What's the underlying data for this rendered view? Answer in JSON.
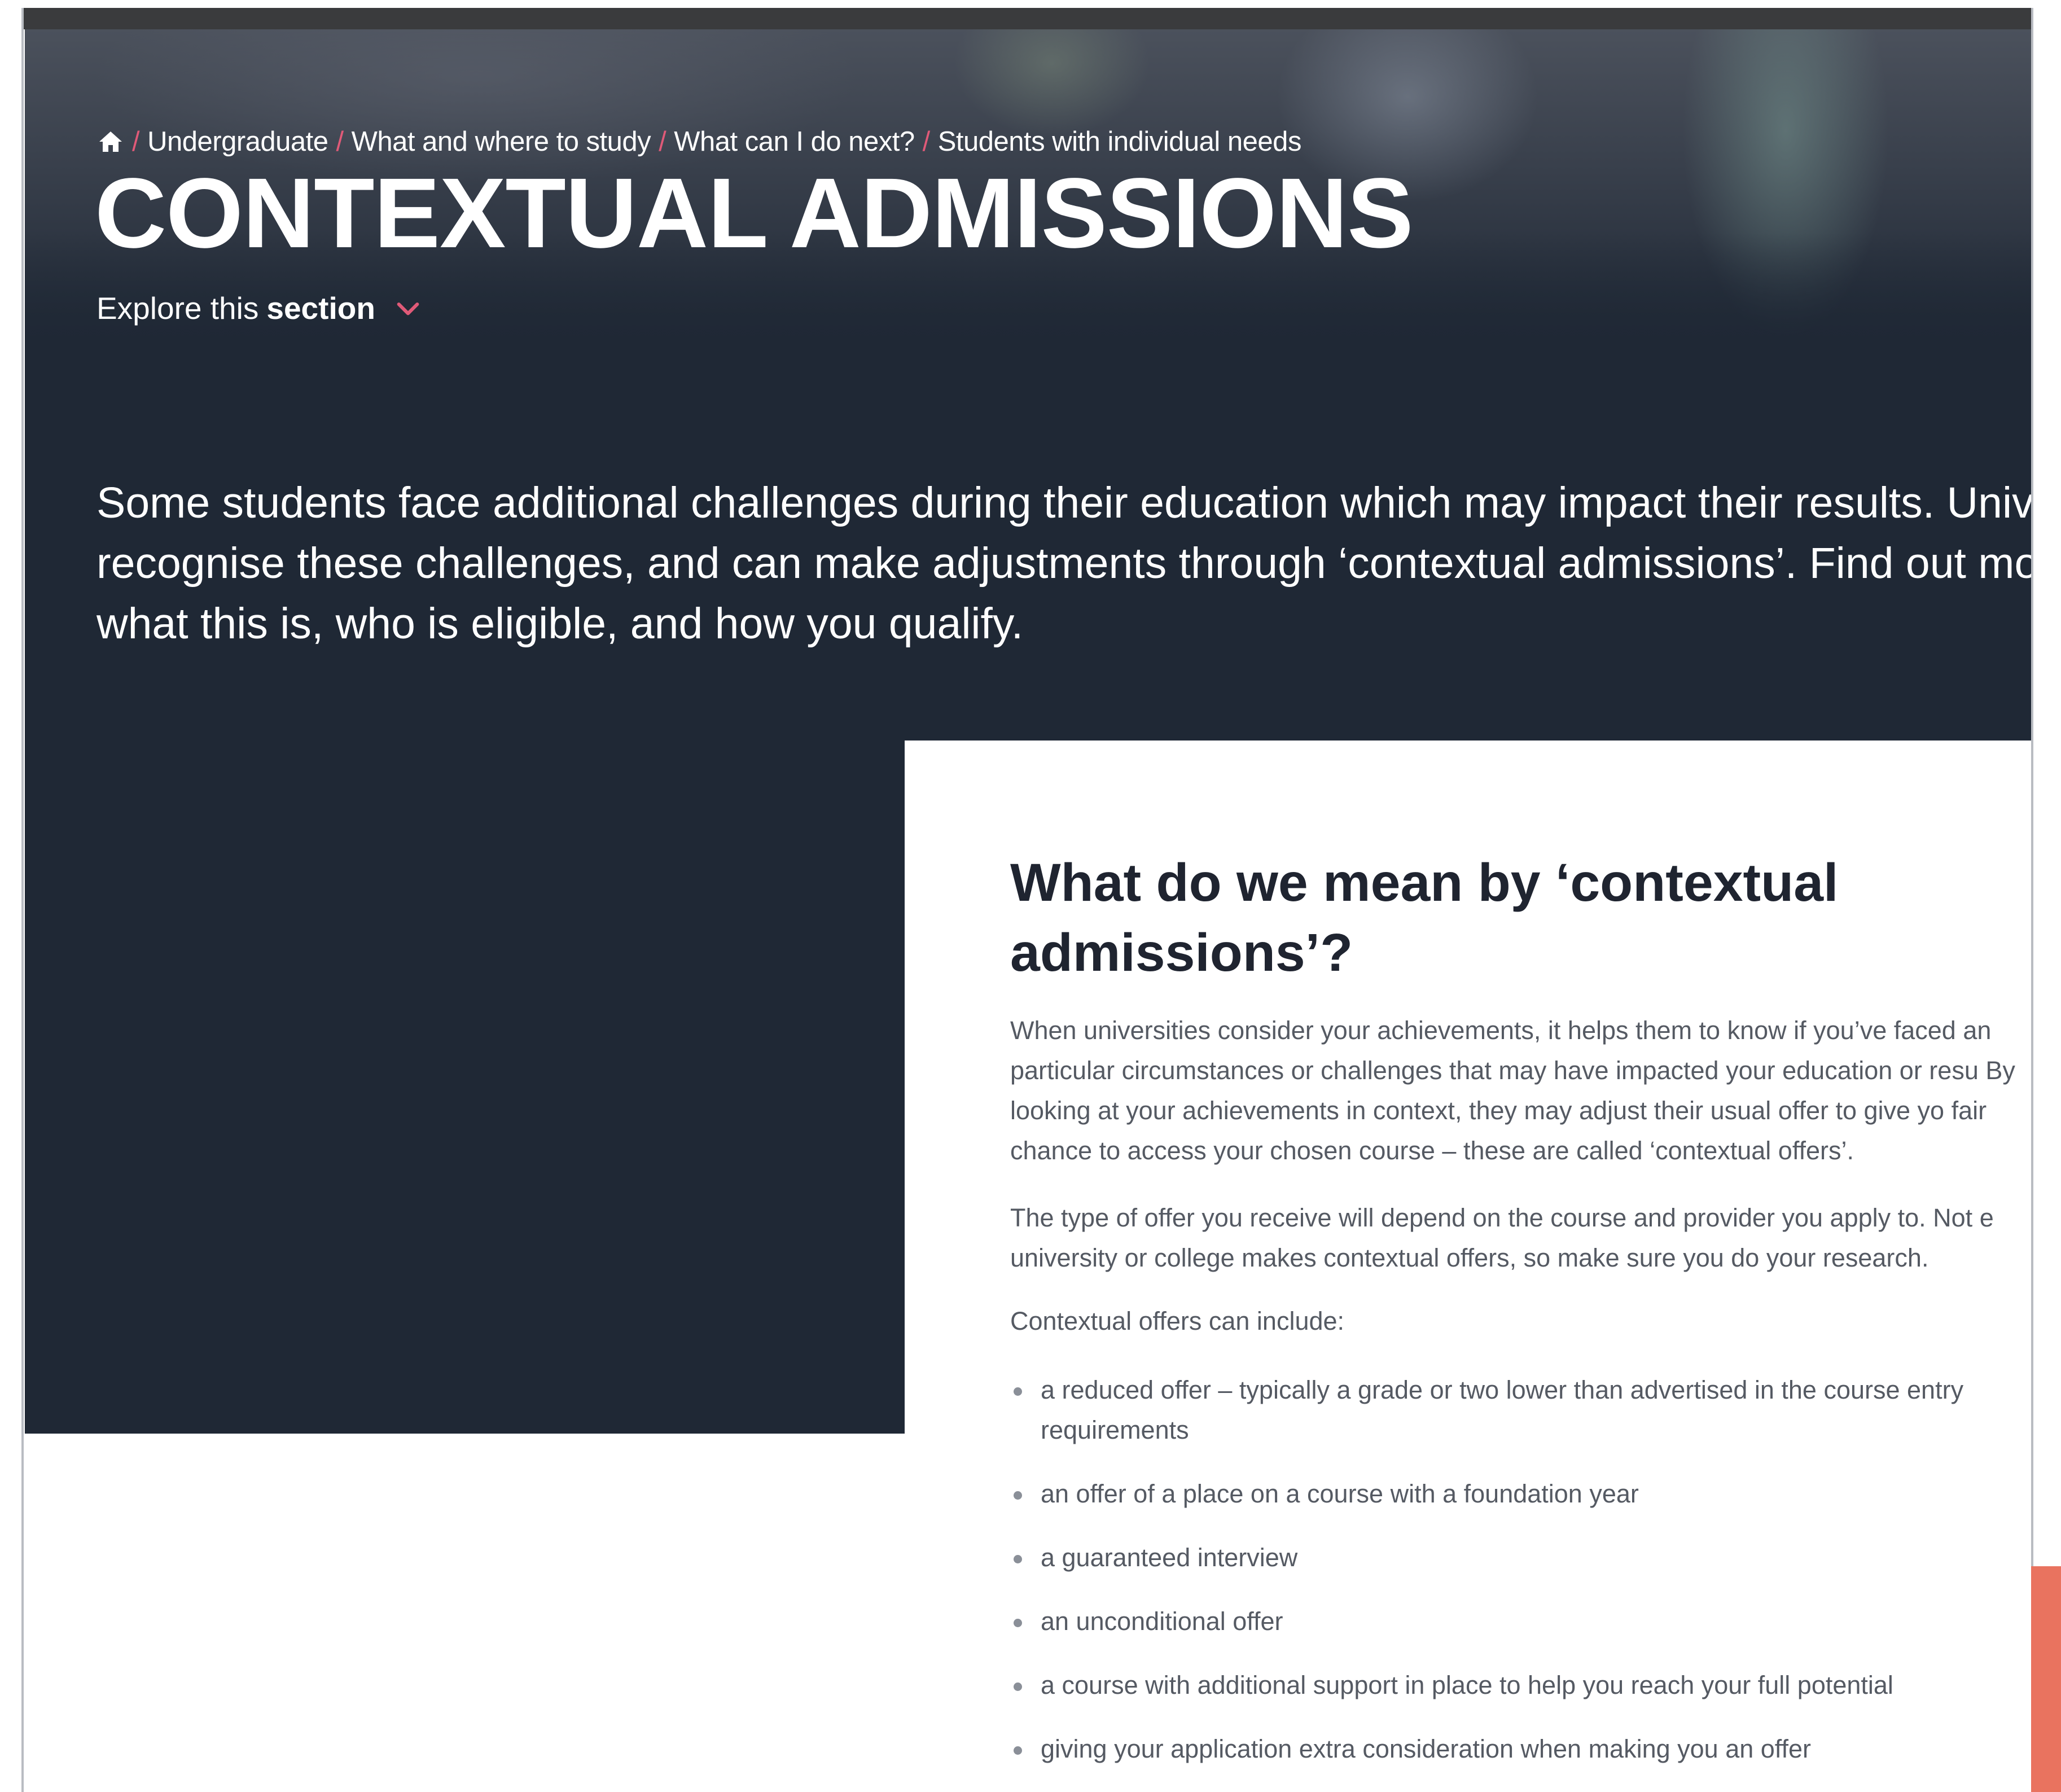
{
  "breadcrumb": {
    "home_icon": "home-icon",
    "items": [
      "Undergraduate",
      "What and where to study",
      "What can I do next?",
      "Students with individual needs"
    ],
    "separator": "/"
  },
  "hero": {
    "title": "CONTEXTUAL ADMISSIONS",
    "explore_prefix": "Explore this",
    "explore_bold": "section",
    "explore_icon": "chevron-down-icon",
    "intro": "Some students face additional challenges during their education which may impact their results. Univ recognise these challenges, and can make adjustments through ‘contextual admissions’. Find out mo what this is, who is eligible, and how you qualify."
  },
  "card": {
    "heading": "What do we mean by ‘contextual admissions’?",
    "paragraph_1": "When universities consider your achievements, it helps them to know if you’ve faced an particular circumstances or challenges that may have impacted your education or resu By looking at your achievements in context, they may adjust their usual offer to give yo fair chance to access your chosen course – these are called ‘contextual offers’.",
    "paragraph_2": "The type of offer you receive will depend on the course and provider you apply to. Not e university or college makes contextual offers, so make sure you do your research.",
    "list_intro": "Contextual offers can include:",
    "offers": [
      "a reduced offer – typically a grade or two lower than advertised in the course entry requirements",
      "an offer of a place on a course with a foundation year",
      "a guaranteed interview",
      "an unconditional offer",
      "a course with additional support in place to help you reach your full potential",
      "giving your application extra consideration when making you an offer"
    ]
  },
  "colors": {
    "hero_background": "#1f2835",
    "accent_pink": "#e05a78",
    "side_tab": "#e9735f",
    "heading_text": "#1f2430",
    "body_text": "#555a63"
  }
}
